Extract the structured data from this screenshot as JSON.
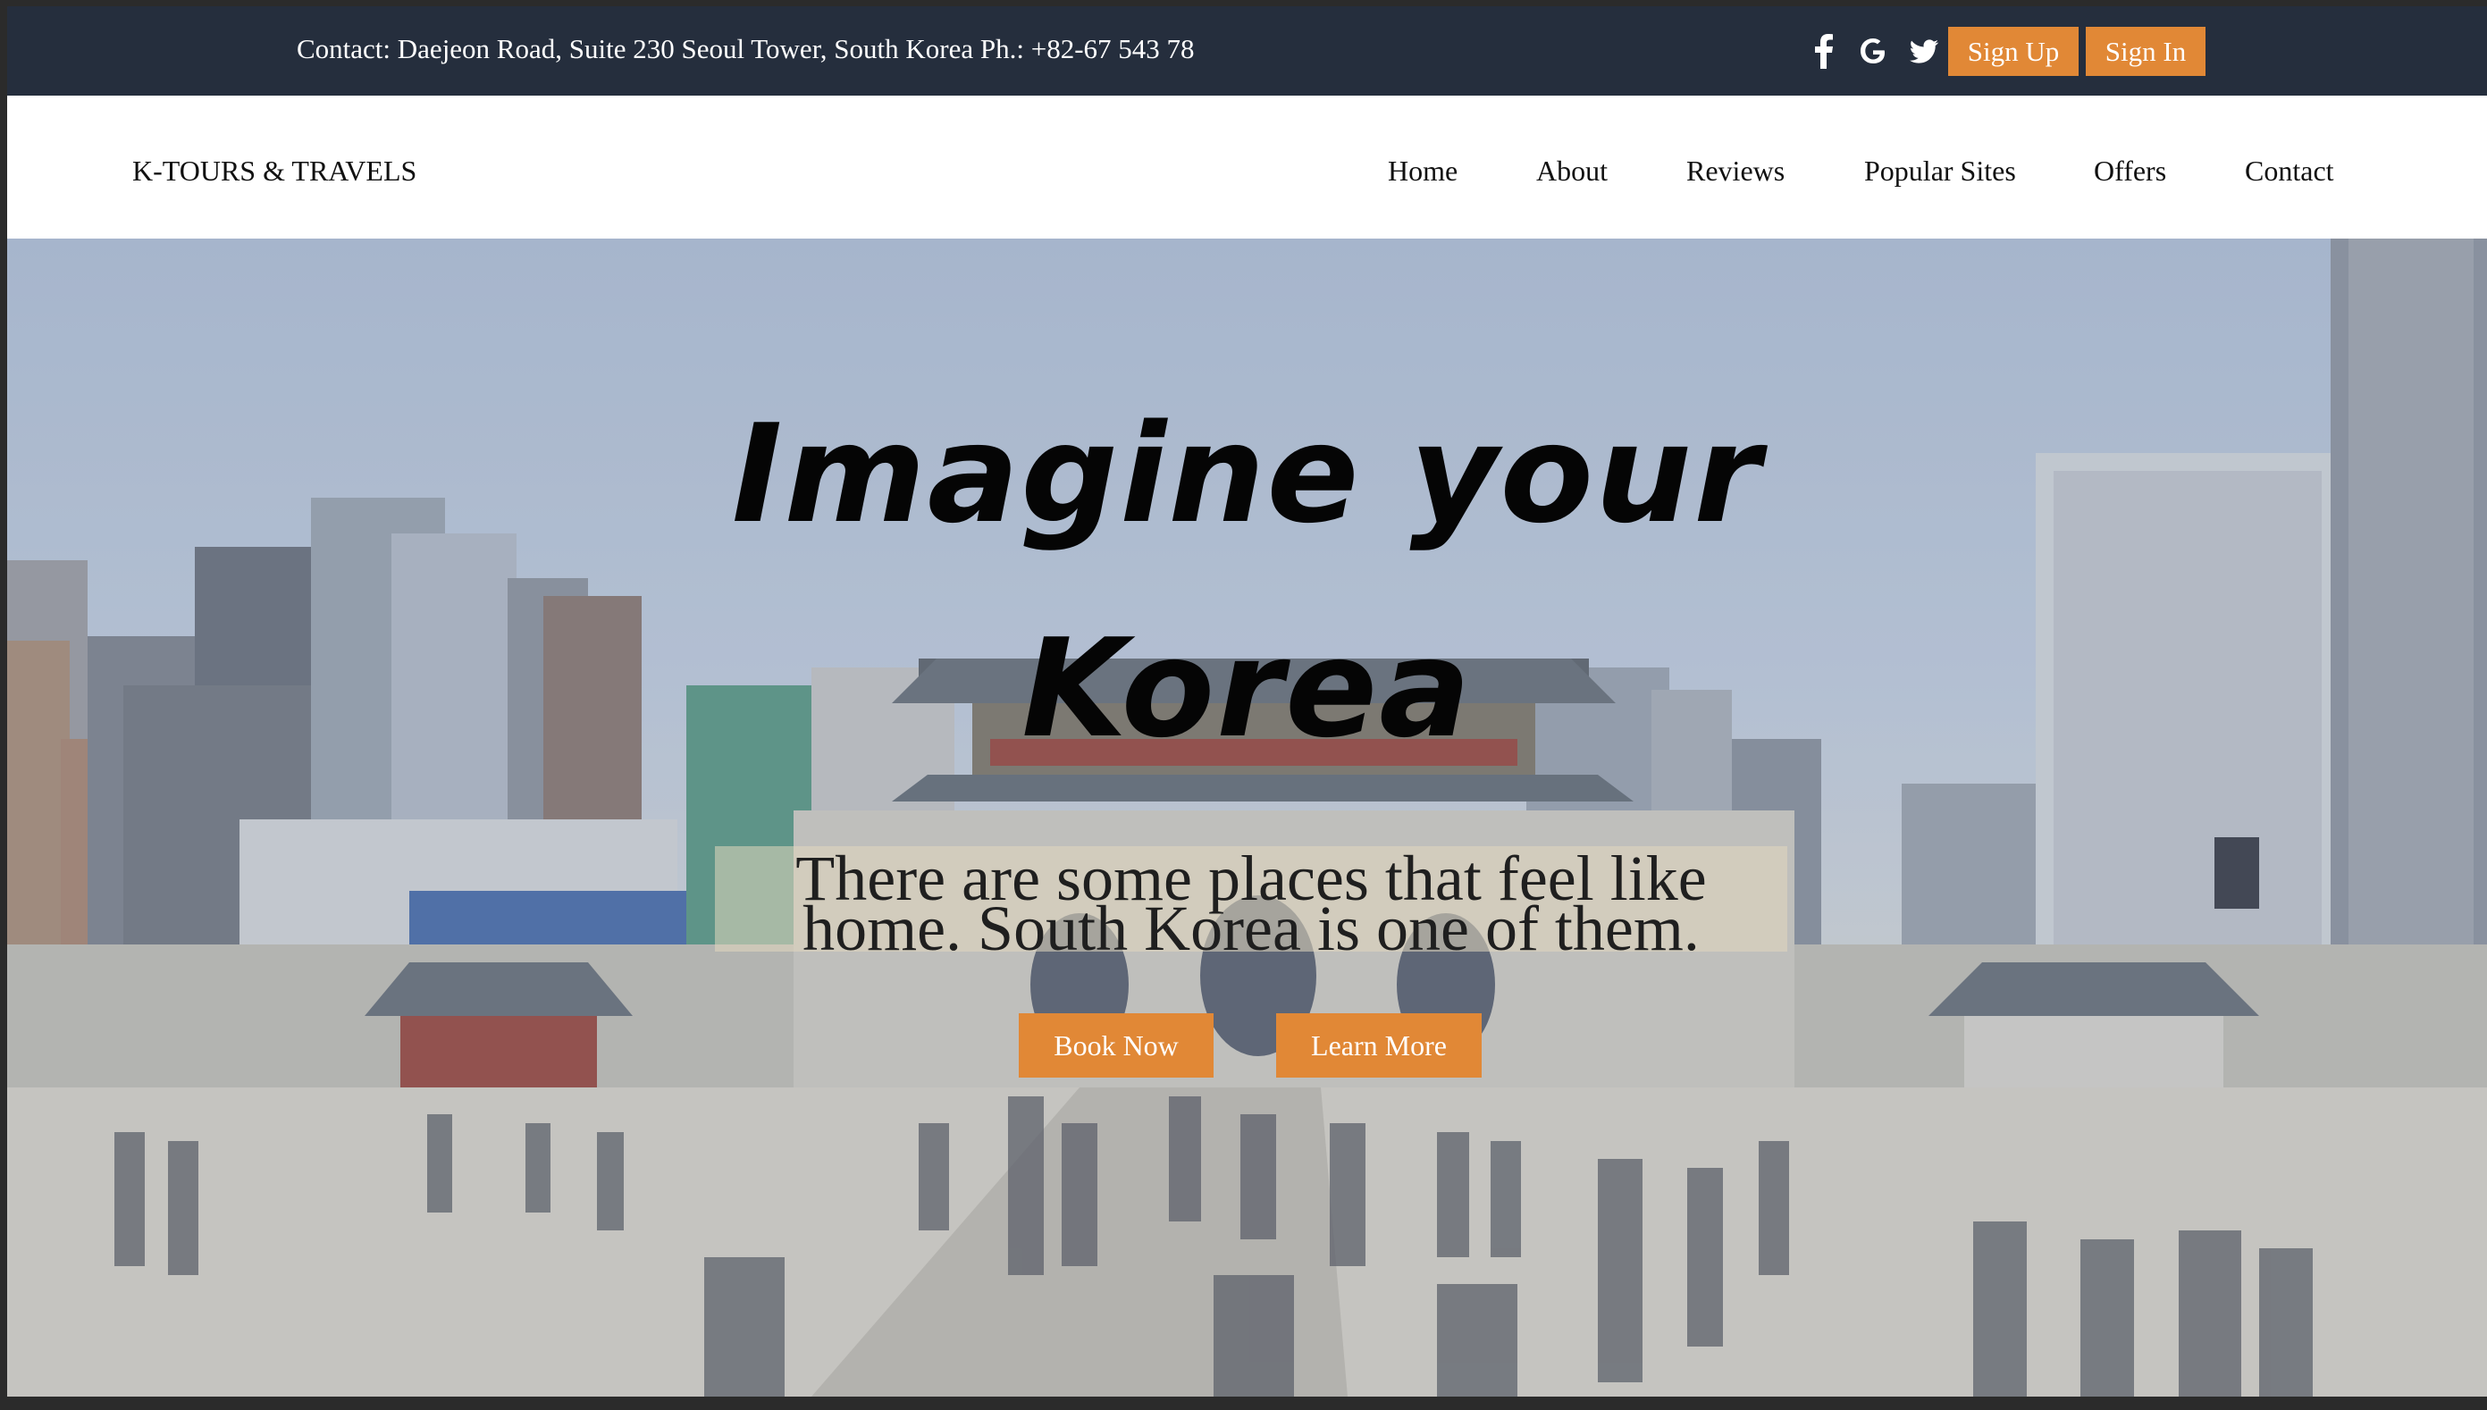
{
  "topbar": {
    "contact": "Contact: Daejeon Road, Suite 230 Seoul Tower, South Korea Ph.: +82-67 543 78",
    "social_icons": [
      "facebook-icon",
      "google-icon",
      "twitter-icon"
    ],
    "signup_label": "Sign Up",
    "signin_label": "Sign In"
  },
  "navbar": {
    "brand": "K-TOURS & TRAVELS",
    "items": [
      "Home",
      "About",
      "Reviews",
      "Popular Sites",
      "Offers",
      "Contact"
    ]
  },
  "hero": {
    "headline_line1": "Imagine your",
    "headline_line2": "Korea",
    "tagline_line1": "There are some places that feel like",
    "tagline_line2": "home. South Korea is one of them.",
    "book_label": "Book Now",
    "learn_label": "Learn More"
  },
  "colors": {
    "topbar_bg": "#252e3d",
    "accent": "#e18836",
    "nav_bg": "#ffffff"
  }
}
